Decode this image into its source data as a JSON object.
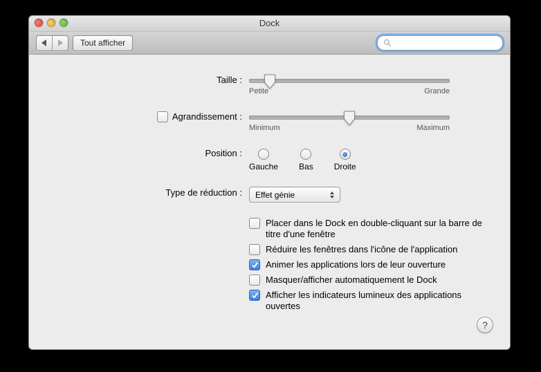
{
  "window": {
    "title": "Dock"
  },
  "toolbar": {
    "show_all_label": "Tout afficher",
    "search_placeholder": ""
  },
  "section": {
    "size": {
      "label": "Taille :",
      "min_label": "Petite",
      "max_label": "Grande",
      "value_pct": 10
    },
    "magnification": {
      "label": "Agrandissement :",
      "checked": false,
      "min_label": "Minimum",
      "max_label": "Maximum",
      "value_pct": 50
    },
    "position": {
      "label": "Position :",
      "options": [
        {
          "key": "left",
          "label": "Gauche",
          "selected": false
        },
        {
          "key": "bottom",
          "label": "Bas",
          "selected": false
        },
        {
          "key": "right",
          "label": "Droite",
          "selected": true
        }
      ]
    },
    "minimize_effect": {
      "label": "Type de réduction :",
      "selected": "Effet génie"
    },
    "checkboxes": [
      {
        "key": "double_click_title",
        "checked": false,
        "label": "Placer dans le Dock en double-cliquant sur la barre de titre d'une fenêtre"
      },
      {
        "key": "minimize_into_app",
        "checked": false,
        "label": "Réduire les fenêtres dans l'icône de l'application"
      },
      {
        "key": "animate_opening",
        "checked": true,
        "label": "Animer les applications lors de leur ouverture"
      },
      {
        "key": "autohide",
        "checked": false,
        "label": "Masquer/afficher automatiquement le Dock"
      },
      {
        "key": "show_indicators",
        "checked": true,
        "label": "Afficher les indicateurs lumineux des applications ouvertes"
      }
    ]
  }
}
